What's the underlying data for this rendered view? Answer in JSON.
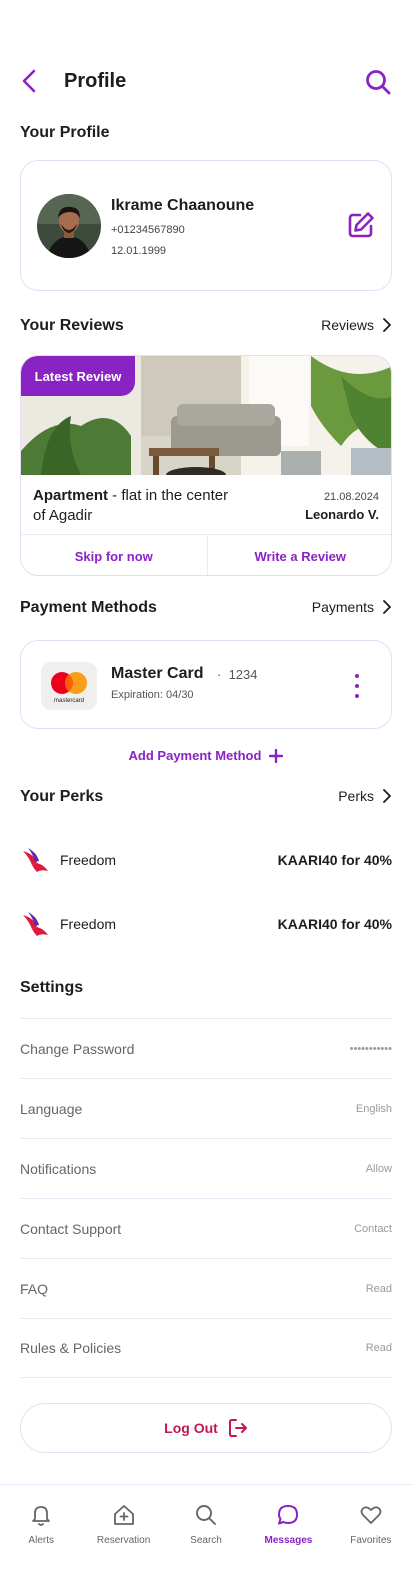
{
  "header": {
    "title": "Profile",
    "back_icon": "chevron-left-icon",
    "search_icon": "search-icon"
  },
  "profile": {
    "section_title": "Your Profile",
    "name": "Ikrame Chaanoune",
    "phone": "+01234567890",
    "birthdate": "12.01.1999",
    "edit_icon": "edit-icon"
  },
  "reviews": {
    "section_title": "Your Reviews",
    "link_label": "Reviews",
    "badge": "Latest Review",
    "property_type": "Apartment",
    "description": " - flat in the center of Agadir",
    "date": "21.08.2024",
    "author": "Leonardo V.",
    "skip_label": "Skip for now",
    "write_label": "Write a Review"
  },
  "payments": {
    "section_title": "Payment Methods",
    "link_label": "Payments",
    "card_brand": "Master Card",
    "card_dot": "·",
    "card_last4": "1234",
    "expiration": "Expiration: 04/30",
    "logo_text": "mastercard",
    "add_label": "Add Payment Method"
  },
  "perks": {
    "section_title": "Your Perks",
    "link_label": "Perks",
    "items": [
      {
        "name": "Freedom",
        "code": "KAARI40 for 40%"
      },
      {
        "name": "Freedom",
        "code": "KAARI40 for 40%"
      }
    ]
  },
  "settings": {
    "section_title": "Settings",
    "items": [
      {
        "label": "Change Password",
        "value": "•••••••••••"
      },
      {
        "label": "Language",
        "value": "English"
      },
      {
        "label": "Notifications",
        "value": "Allow"
      },
      {
        "label": "Contact Support",
        "value": "Contact"
      },
      {
        "label": "FAQ",
        "value": "Read"
      },
      {
        "label": "Rules & Policies",
        "value": "Read"
      }
    ]
  },
  "logout_label": "Log Out",
  "nav": {
    "items": [
      {
        "label": "Alerts",
        "icon": "bell-icon"
      },
      {
        "label": "Reservation",
        "icon": "home-plus-icon"
      },
      {
        "label": "Search",
        "icon": "search-icon"
      },
      {
        "label": "Messages",
        "icon": "chat-icon",
        "active": true
      },
      {
        "label": "Favorites",
        "icon": "heart-icon"
      }
    ]
  },
  "colors": {
    "accent": "#8a23c4",
    "logout": "#c1184d",
    "border": "#e6def4"
  }
}
